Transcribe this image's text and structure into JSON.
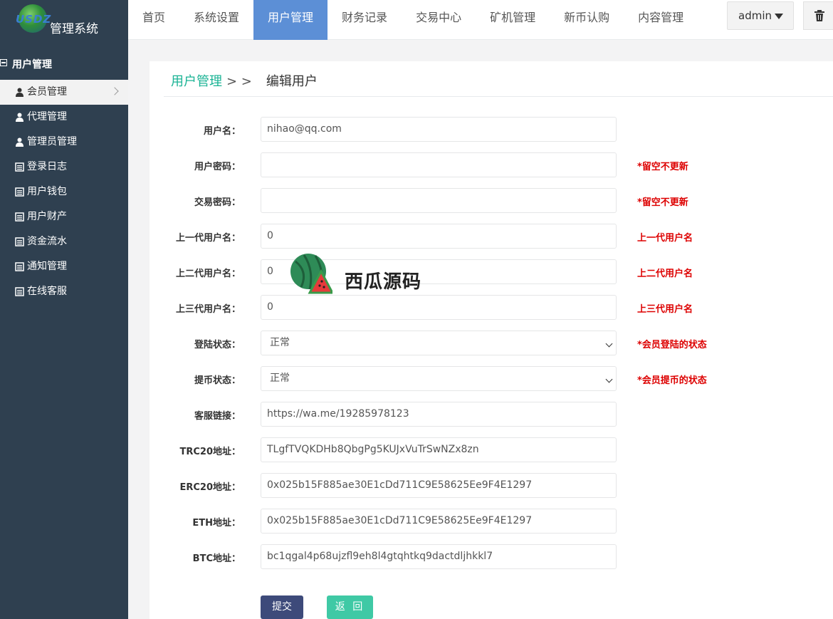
{
  "brand": {
    "logo_text": "USDZ",
    "system_name": "管理系统"
  },
  "nav": {
    "items": [
      {
        "label": "首页",
        "active": false
      },
      {
        "label": "系统设置",
        "active": false
      },
      {
        "label": "用户管理",
        "active": true
      },
      {
        "label": "财务记录",
        "active": false
      },
      {
        "label": "交易中心",
        "active": false
      },
      {
        "label": "矿机管理",
        "active": false
      },
      {
        "label": "新币认购",
        "active": false
      },
      {
        "label": "内容管理",
        "active": false
      }
    ],
    "admin_label": "admin"
  },
  "sidebar": {
    "section_title": "用户管理",
    "items": [
      {
        "label": "会员管理",
        "icon": "user-icon",
        "active": true
      },
      {
        "label": "代理管理",
        "icon": "user-icon",
        "active": false
      },
      {
        "label": "管理员管理",
        "icon": "user-icon",
        "active": false
      },
      {
        "label": "登录日志",
        "icon": "list-icon",
        "active": false
      },
      {
        "label": "用户钱包",
        "icon": "list-icon",
        "active": false
      },
      {
        "label": "用户财产",
        "icon": "list-icon",
        "active": false
      },
      {
        "label": "资金流水",
        "icon": "list-icon",
        "active": false
      },
      {
        "label": "通知管理",
        "icon": "list-icon",
        "active": false
      },
      {
        "label": "在线客服",
        "icon": "list-icon",
        "active": false
      }
    ]
  },
  "breadcrumb": {
    "parent": "用户管理",
    "separator": "> >",
    "current": "编辑用户"
  },
  "form": {
    "rows": [
      {
        "label": "用户名：",
        "value": "nihao@qq.com",
        "hint": ""
      },
      {
        "label": "用户密码：",
        "value": "",
        "hint": "*留空不更新"
      },
      {
        "label": "交易密码：",
        "value": "",
        "hint": "*留空不更新"
      },
      {
        "label": "上一代用户名：",
        "value": "0",
        "hint": "上一代用户名"
      },
      {
        "label": "上二代用户名：",
        "value": "0",
        "hint": "上二代用户名"
      },
      {
        "label": "上三代用户名：",
        "value": "0",
        "hint": "上三代用户名"
      },
      {
        "label": "登陆状态：",
        "value": "正常",
        "hint": "*会员登陆的状态"
      },
      {
        "label": "提币状态：",
        "value": "正常",
        "hint": "*会员提币的状态"
      },
      {
        "label": "客服链接：",
        "value": "https://wa.me/19285978123",
        "hint": ""
      },
      {
        "label": "TRC20地址：",
        "value": "TLgfTVQKDHb8QbgPg5KUJxVuTrSwNZx8zn",
        "hint": ""
      },
      {
        "label": "ERC20地址：",
        "value": "0x025b15F885ae30E1cDd711C9E58625Ee9F4E1297",
        "hint": ""
      },
      {
        "label": "ETH地址：",
        "value": "0x025b15F885ae30E1cDd711C9E58625Ee9F4E1297",
        "hint": ""
      },
      {
        "label": "BTC地址：",
        "value": "bc1qgal4p68ujzfl9eh8l4gtqhtkq9dactdljhkkl7",
        "hint": ""
      }
    ],
    "submit_label": "提交",
    "back_label": "返 回"
  },
  "watermark": {
    "text": "西瓜源码"
  },
  "colors": {
    "sidebar_bg": "#2f4050",
    "nav_active": "#5c8fd6",
    "accent_green": "#1ab394",
    "hint_red": "#dd0000",
    "submit_bg": "#3d4a7a",
    "back_bg": "#3fc9a5"
  }
}
